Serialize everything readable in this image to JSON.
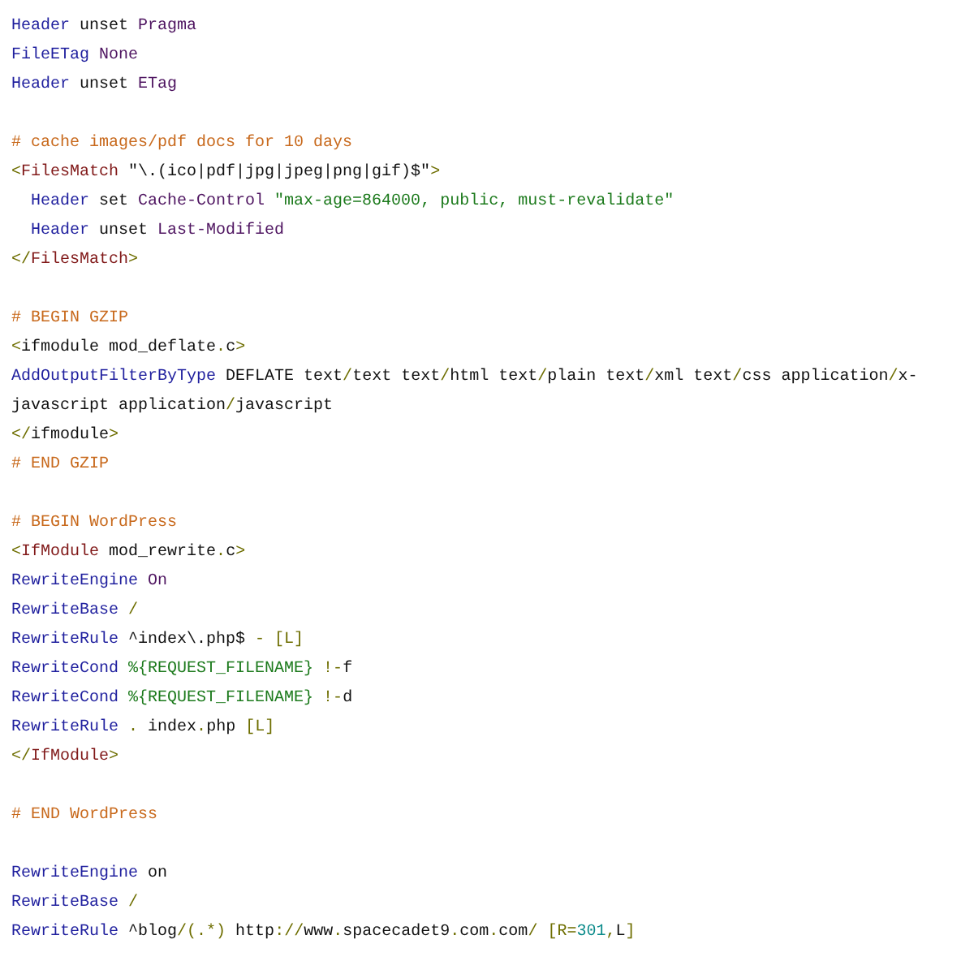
{
  "lines": [
    {
      "kind": "code",
      "tokens": [
        {
          "kind": "directive",
          "text": "Header"
        },
        {
          "kind": "plain",
          "text": " unset "
        },
        {
          "kind": "value",
          "text": "Pragma"
        }
      ]
    },
    {
      "kind": "code",
      "tokens": [
        {
          "kind": "directive",
          "text": "FileETag"
        },
        {
          "kind": "value",
          "text": " None"
        }
      ]
    },
    {
      "kind": "code",
      "tokens": [
        {
          "kind": "directive",
          "text": "Header"
        },
        {
          "kind": "plain",
          "text": " unset "
        },
        {
          "kind": "value",
          "text": "ETag"
        }
      ]
    },
    {
      "kind": "blank"
    },
    {
      "kind": "code",
      "tokens": [
        {
          "kind": "comment",
          "text": "# cache images/pdf docs for 10 days"
        }
      ]
    },
    {
      "kind": "code",
      "tokens": [
        {
          "kind": "punct",
          "text": "<"
        },
        {
          "kind": "tag",
          "text": "FilesMatch"
        },
        {
          "kind": "plain",
          "text": " \"\\.(ico|pdf|jpg|jpeg|png|gif)$\""
        },
        {
          "kind": "punct",
          "text": ">"
        }
      ]
    },
    {
      "kind": "code",
      "tokens": [
        {
          "kind": "directive",
          "text": "  Header"
        },
        {
          "kind": "plain",
          "text": " set "
        },
        {
          "kind": "value",
          "text": "Cache-Control"
        },
        {
          "kind": "string",
          "text": " \"max-age=864000, public, must-revalidate\""
        }
      ]
    },
    {
      "kind": "code",
      "tokens": [
        {
          "kind": "directive",
          "text": "  Header"
        },
        {
          "kind": "plain",
          "text": " unset "
        },
        {
          "kind": "value",
          "text": "Last-Modified"
        }
      ]
    },
    {
      "kind": "code",
      "tokens": [
        {
          "kind": "punct",
          "text": "</"
        },
        {
          "kind": "tag",
          "text": "FilesMatch"
        },
        {
          "kind": "punct",
          "text": ">"
        }
      ]
    },
    {
      "kind": "blank"
    },
    {
      "kind": "code",
      "tokens": [
        {
          "kind": "comment",
          "text": "# BEGIN GZIP"
        }
      ]
    },
    {
      "kind": "code",
      "tokens": [
        {
          "kind": "punct",
          "text": "<"
        },
        {
          "kind": "plain",
          "text": "ifmodule mod_deflate"
        },
        {
          "kind": "punct",
          "text": "."
        },
        {
          "kind": "plain",
          "text": "c"
        },
        {
          "kind": "punct",
          "text": ">"
        }
      ]
    },
    {
      "kind": "code",
      "tokens": [
        {
          "kind": "directive",
          "text": "AddOutputFilterByType"
        },
        {
          "kind": "plain",
          "text": " DEFLATE text"
        },
        {
          "kind": "punct",
          "text": "/"
        },
        {
          "kind": "plain",
          "text": "text text"
        },
        {
          "kind": "punct",
          "text": "/"
        },
        {
          "kind": "plain",
          "text": "html text"
        },
        {
          "kind": "punct",
          "text": "/"
        },
        {
          "kind": "plain",
          "text": "plain text"
        },
        {
          "kind": "punct",
          "text": "/"
        },
        {
          "kind": "plain",
          "text": "xml text"
        },
        {
          "kind": "punct",
          "text": "/"
        },
        {
          "kind": "plain",
          "text": "css application"
        },
        {
          "kind": "punct",
          "text": "/"
        },
        {
          "kind": "plain",
          "text": "x-"
        }
      ]
    },
    {
      "kind": "code",
      "tokens": [
        {
          "kind": "plain",
          "text": "javascript application"
        },
        {
          "kind": "punct",
          "text": "/"
        },
        {
          "kind": "plain",
          "text": "javascript"
        }
      ]
    },
    {
      "kind": "code",
      "tokens": [
        {
          "kind": "punct",
          "text": "</"
        },
        {
          "kind": "plain",
          "text": "ifmodule"
        },
        {
          "kind": "punct",
          "text": ">"
        }
      ]
    },
    {
      "kind": "code",
      "tokens": [
        {
          "kind": "comment",
          "text": "# END GZIP"
        }
      ]
    },
    {
      "kind": "blank"
    },
    {
      "kind": "code",
      "tokens": [
        {
          "kind": "comment",
          "text": "# BEGIN WordPress"
        }
      ]
    },
    {
      "kind": "code",
      "tokens": [
        {
          "kind": "punct",
          "text": "<"
        },
        {
          "kind": "tag",
          "text": "IfModule"
        },
        {
          "kind": "plain",
          "text": " mod_rewrite"
        },
        {
          "kind": "punct",
          "text": "."
        },
        {
          "kind": "plain",
          "text": "c"
        },
        {
          "kind": "punct",
          "text": ">"
        }
      ]
    },
    {
      "kind": "code",
      "tokens": [
        {
          "kind": "directive",
          "text": "RewriteEngine"
        },
        {
          "kind": "value",
          "text": " On"
        }
      ]
    },
    {
      "kind": "code",
      "tokens": [
        {
          "kind": "directive",
          "text": "RewriteBase"
        },
        {
          "kind": "punct",
          "text": " /"
        }
      ]
    },
    {
      "kind": "code",
      "tokens": [
        {
          "kind": "directive",
          "text": "RewriteRule"
        },
        {
          "kind": "plain",
          "text": " ^index\\.php$ "
        },
        {
          "kind": "punct",
          "text": "- [L]"
        }
      ]
    },
    {
      "kind": "code",
      "tokens": [
        {
          "kind": "directive",
          "text": "RewriteCond"
        },
        {
          "kind": "string",
          "text": " %{REQUEST_FILENAME}"
        },
        {
          "kind": "punct",
          "text": " !-"
        },
        {
          "kind": "plain",
          "text": "f"
        }
      ]
    },
    {
      "kind": "code",
      "tokens": [
        {
          "kind": "directive",
          "text": "RewriteCond"
        },
        {
          "kind": "string",
          "text": " %{REQUEST_FILENAME}"
        },
        {
          "kind": "punct",
          "text": " !-"
        },
        {
          "kind": "plain",
          "text": "d"
        }
      ]
    },
    {
      "kind": "code",
      "tokens": [
        {
          "kind": "directive",
          "text": "RewriteRule"
        },
        {
          "kind": "punct",
          "text": " ."
        },
        {
          "kind": "plain",
          "text": " index"
        },
        {
          "kind": "punct",
          "text": "."
        },
        {
          "kind": "plain",
          "text": "php "
        },
        {
          "kind": "punct",
          "text": "[L]"
        }
      ]
    },
    {
      "kind": "code",
      "tokens": [
        {
          "kind": "punct",
          "text": "</"
        },
        {
          "kind": "tag",
          "text": "IfModule"
        },
        {
          "kind": "punct",
          "text": ">"
        }
      ]
    },
    {
      "kind": "blank"
    },
    {
      "kind": "code",
      "tokens": [
        {
          "kind": "comment",
          "text": "# END WordPress"
        }
      ]
    },
    {
      "kind": "blank"
    },
    {
      "kind": "code",
      "tokens": [
        {
          "kind": "directive",
          "text": "RewriteEngine"
        },
        {
          "kind": "plain",
          "text": " on"
        }
      ]
    },
    {
      "kind": "code",
      "tokens": [
        {
          "kind": "directive",
          "text": "RewriteBase"
        },
        {
          "kind": "punct",
          "text": " /"
        }
      ]
    },
    {
      "kind": "code",
      "tokens": [
        {
          "kind": "directive",
          "text": "RewriteRule"
        },
        {
          "kind": "plain",
          "text": " ^blog"
        },
        {
          "kind": "punct",
          "text": "/(.*)"
        },
        {
          "kind": "plain",
          "text": " http"
        },
        {
          "kind": "punct",
          "text": "://"
        },
        {
          "kind": "plain",
          "text": "www"
        },
        {
          "kind": "punct",
          "text": "."
        },
        {
          "kind": "plain",
          "text": "spacecadet9"
        },
        {
          "kind": "punct",
          "text": "."
        },
        {
          "kind": "plain",
          "text": "com"
        },
        {
          "kind": "punct",
          "text": "."
        },
        {
          "kind": "plain",
          "text": "com"
        },
        {
          "kind": "punct",
          "text": "/ [R="
        },
        {
          "kind": "number",
          "text": "301"
        },
        {
          "kind": "punct",
          "text": ","
        },
        {
          "kind": "plain",
          "text": "L"
        },
        {
          "kind": "punct",
          "text": "]"
        }
      ]
    }
  ]
}
